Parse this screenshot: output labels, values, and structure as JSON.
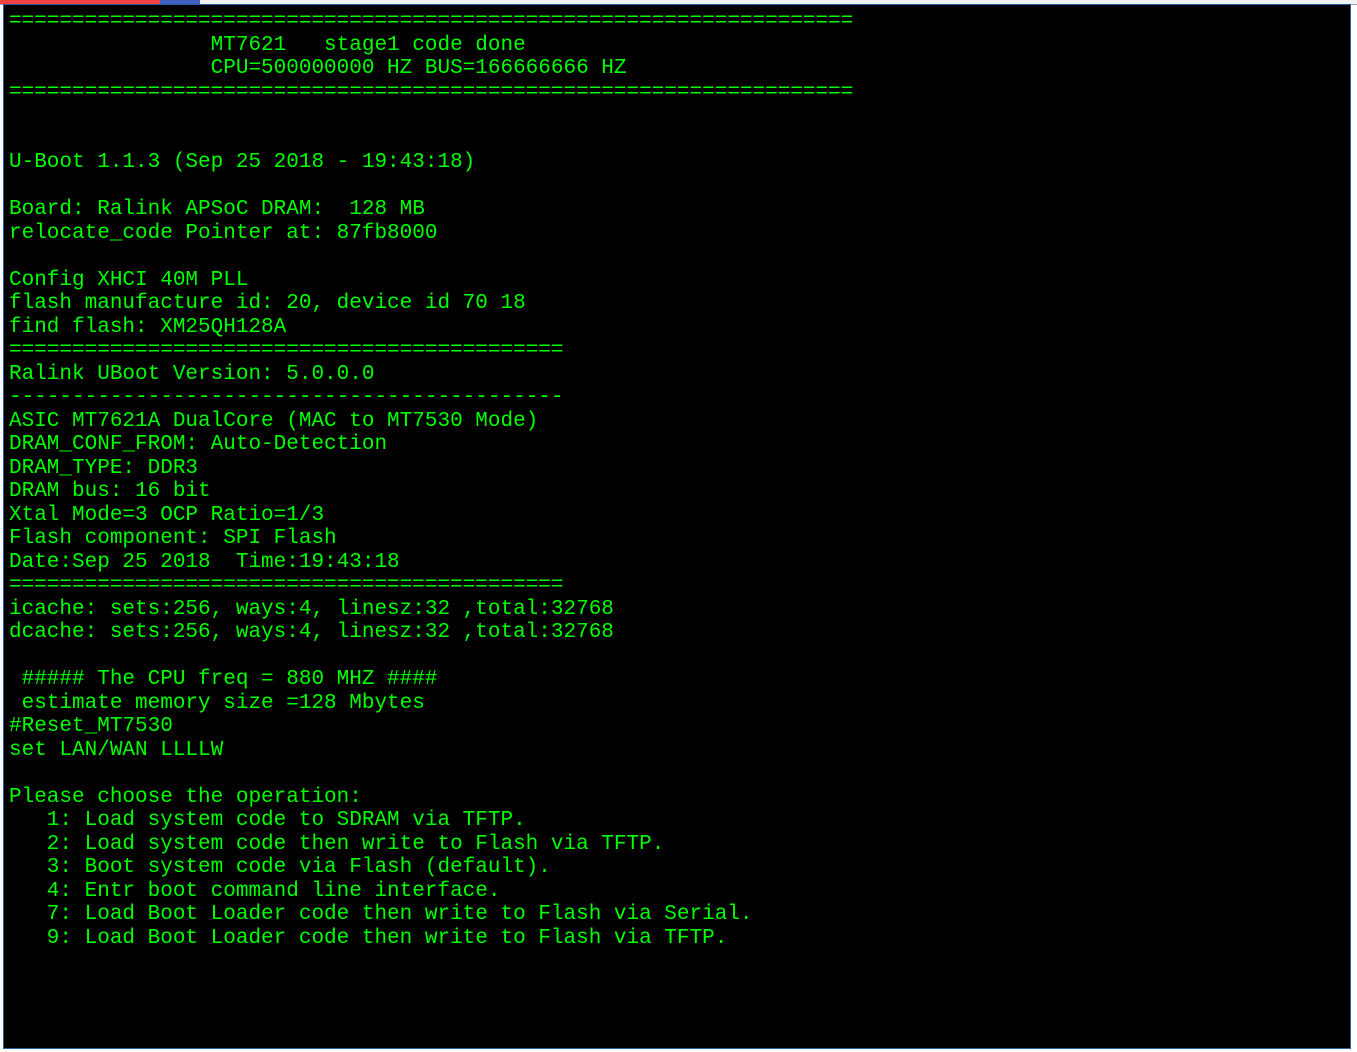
{
  "terminal": {
    "colors": {
      "fg": "#00ff00",
      "bg": "#000000"
    },
    "lines": [
      "===================================================================",
      "                MT7621   stage1 code done ",
      "                CPU=500000000 HZ BUS=166666666 HZ",
      "===================================================================",
      "",
      "",
      "U-Boot 1.1.3 (Sep 25 2018 - 19:43:18)",
      "",
      "Board: Ralink APSoC DRAM:  128 MB",
      "relocate_code Pointer at: 87fb8000",
      "",
      "Config XHCI 40M PLL ",
      "flash manufacture id: 20, device id 70 18",
      "find flash: XM25QH128A",
      "============================================ ",
      "Ralink UBoot Version: 5.0.0.0",
      "-------------------------------------------- ",
      "ASIC MT7621A DualCore (MAC to MT7530 Mode)",
      "DRAM_CONF_FROM: Auto-Detection ",
      "DRAM_TYPE: DDR3 ",
      "DRAM bus: 16 bit",
      "Xtal Mode=3 OCP Ratio=1/3",
      "Flash component: SPI Flash",
      "Date:Sep 25 2018  Time:19:43:18",
      "============================================ ",
      "icache: sets:256, ways:4, linesz:32 ,total:32768",
      "dcache: sets:256, ways:4, linesz:32 ,total:32768 ",
      "",
      " ##### The CPU freq = 880 MHZ #### ",
      " estimate memory size =128 Mbytes",
      "#Reset_MT7530",
      "set LAN/WAN LLLLW",
      "",
      "Please choose the operation: ",
      "   1: Load system code to SDRAM via TFTP. ",
      "   2: Load system code then write to Flash via TFTP. ",
      "   3: Boot system code via Flash (default). ",
      "   4: Entr boot command line interface.",
      "   7: Load Boot Loader code then write to Flash via Serial. ",
      "   9: Load Boot Loader code then write to Flash via TFTP. "
    ],
    "menu_options": [
      {
        "key": "1",
        "label": "Load system code to SDRAM via TFTP."
      },
      {
        "key": "2",
        "label": "Load system code then write to Flash via TFTP."
      },
      {
        "key": "3",
        "label": "Boot system code via Flash (default)."
      },
      {
        "key": "4",
        "label": "Entr boot command line interface."
      },
      {
        "key": "7",
        "label": "Load Boot Loader code then write to Flash via Serial."
      },
      {
        "key": "9",
        "label": "Load Boot Loader code then write to Flash via TFTP."
      }
    ]
  }
}
